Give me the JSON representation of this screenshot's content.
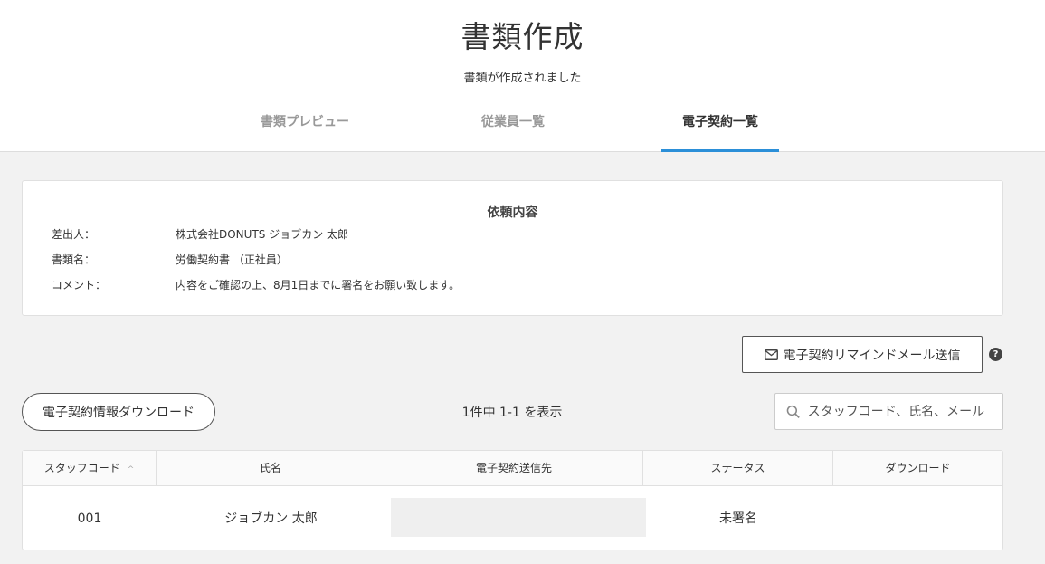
{
  "header": {
    "title": "書類作成",
    "subtitle": "書類が作成されました",
    "tabs": [
      {
        "label": "書類プレビュー",
        "active": false
      },
      {
        "label": "従業員一覧",
        "active": false
      },
      {
        "label": "電子契約一覧",
        "active": true
      }
    ]
  },
  "request": {
    "heading": "依頼内容",
    "rows": [
      {
        "key": "差出人：",
        "value": "株式会社DONUTS ジョブカン 太郎"
      },
      {
        "key": "書類名：",
        "value": "労働契約書 （正社員）"
      },
      {
        "key": "コメント：",
        "value": "内容をご確認の上、8月1日までに署名をお願い致します。"
      }
    ]
  },
  "toolbar": {
    "remind_label": "電子契約リマインドメール送信",
    "help_icon": "?",
    "download_label": "電子契約情報ダウンロード",
    "count_text": "1件中 1-1 を表示",
    "search_placeholder": "スタッフコード、氏名、メール"
  },
  "table": {
    "columns": [
      "スタッフコード",
      "氏名",
      "電子契約送信先",
      "ステータス",
      "ダウンロード"
    ],
    "sort_icon": "^",
    "rows": [
      {
        "code": "001",
        "name": "ジョブカン 太郎",
        "destination": "",
        "status": "未署名",
        "download": ""
      }
    ]
  },
  "colors": {
    "accent": "#2b8fd8",
    "background": "#f2f2f2"
  }
}
